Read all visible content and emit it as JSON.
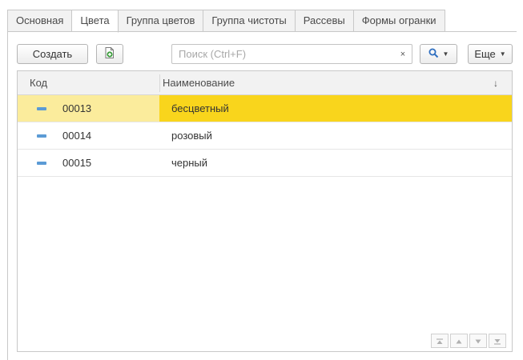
{
  "tabs": [
    {
      "label": "Основная"
    },
    {
      "label": "Цвета",
      "active": true
    },
    {
      "label": "Группа цветов"
    },
    {
      "label": "Группа чистоты"
    },
    {
      "label": "Рассевы"
    },
    {
      "label": "Формы огранки"
    }
  ],
  "toolbar": {
    "create_label": "Создать",
    "copy_icon": "add-copy-icon",
    "search_placeholder": "Поиск (Ctrl+F)",
    "search_value": "",
    "clear_label": "×",
    "search_icon": "search-icon",
    "more_label": "Еще"
  },
  "table": {
    "columns": {
      "code": "Код",
      "name": "Наименование",
      "sort_indicator": "↓"
    },
    "rows": [
      {
        "code": "00013",
        "name": "бесцветный",
        "selected": true
      },
      {
        "code": "00014",
        "name": "розовый",
        "selected": false
      },
      {
        "code": "00015",
        "name": "черный",
        "selected": false
      }
    ]
  },
  "navigation": [
    "first-page-icon",
    "prev-page-icon",
    "next-page-icon",
    "last-page-icon"
  ],
  "colors": {
    "selected_row": "#f9d51c",
    "selected_row_code": "#fbec9c",
    "row_icon": "#5b9bd5",
    "search_accent": "#2f6fc0",
    "copy_icon_green": "#3c9c3c"
  }
}
